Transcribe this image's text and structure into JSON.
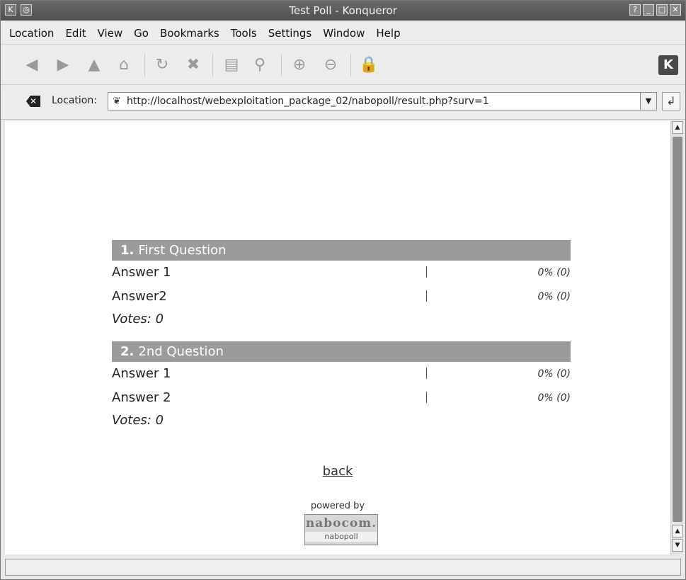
{
  "window": {
    "title": "Test Poll - Konqueror",
    "buttons": [
      "?",
      "_",
      "□",
      "✕"
    ]
  },
  "menubar": [
    "Location",
    "Edit",
    "View",
    "Go",
    "Bookmarks",
    "Tools",
    "Settings",
    "Window",
    "Help"
  ],
  "toolbar": {
    "icons": [
      "back-icon",
      "forward-icon",
      "up-icon",
      "home-icon",
      "reload-icon",
      "stop-icon",
      "print-icon",
      "find-icon",
      "zoom-in-icon",
      "zoom-out-icon",
      "security-icon",
      "kde-logo-icon"
    ]
  },
  "location_bar": {
    "label": "Location:",
    "url": "http://localhost/webexploitation_package_02/nabopoll/result.php?surv=1"
  },
  "poll": {
    "questions": [
      {
        "number": "1.",
        "title": "First Question",
        "answers": [
          {
            "label": "Answer 1",
            "result": "0% (0)"
          },
          {
            "label": "Answer2",
            "result": "0% (0)"
          }
        ],
        "votes": "Votes: 0"
      },
      {
        "number": "2.",
        "title": "2nd Question",
        "answers": [
          {
            "label": "Answer 1",
            "result": "0% (0)"
          },
          {
            "label": "Answer 2",
            "result": "0% (0)"
          }
        ],
        "votes": "Votes: 0"
      }
    ],
    "back_link": "back",
    "powered_by": "powered by",
    "logo_text": "nabocom.",
    "logo_subtext": "nabopoll"
  },
  "statusbar": {
    "text": ""
  }
}
